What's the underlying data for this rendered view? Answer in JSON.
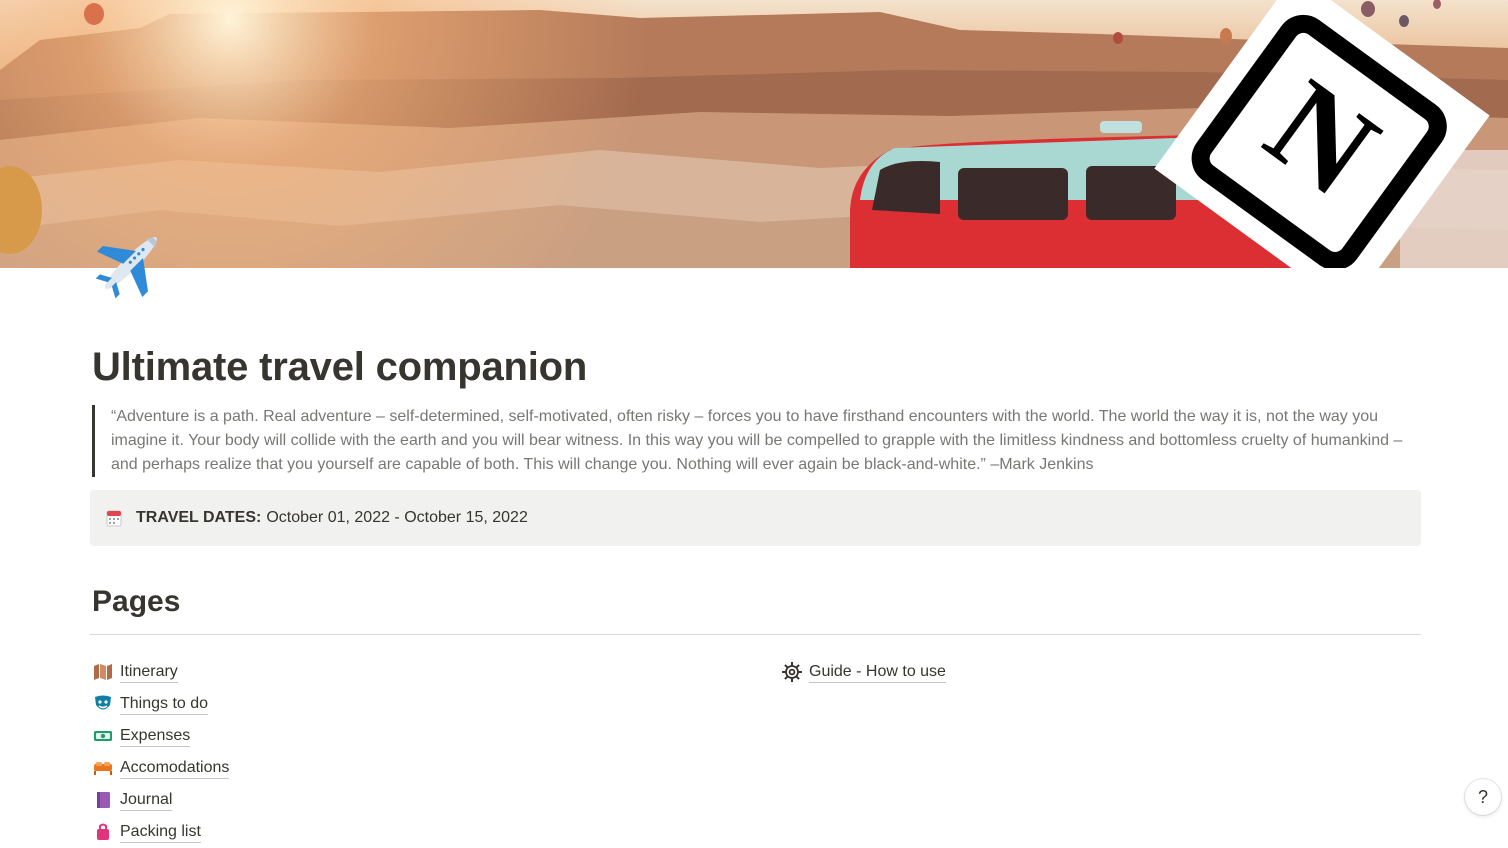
{
  "page": {
    "title": "Ultimate travel companion",
    "icon": "airplane-icon",
    "quote": "“Adventure is a path. Real adventure – self-determined, self-motivated, often risky – forces you to have firsthand encounters with the world. The world the way it is, not the way you imagine it. Your body will collide with the earth and you will bear witness. In this way you will be compelled to grapple with the limitless kindness and bottomless cruelty of humankind – and perhaps realize that you yourself are capable of both. This will change you. Nothing will ever again be black-and-white.” –Mark Jenkins"
  },
  "callout": {
    "icon": "calendar-icon",
    "label": "TRAVEL DATES:",
    "value": "October 01, 2022 - October 15, 2022"
  },
  "pages_section": {
    "heading": "Pages",
    "left_links": [
      {
        "label": "Itinerary",
        "icon": "map-icon"
      },
      {
        "label": "Things to do",
        "icon": "masks-icon"
      },
      {
        "label": "Expenses",
        "icon": "money-icon"
      },
      {
        "label": "Accomodations",
        "icon": "bed-icon"
      },
      {
        "label": "Journal",
        "icon": "book-icon"
      },
      {
        "label": "Packing list",
        "icon": "bag-icon"
      }
    ],
    "right_links": [
      {
        "label": "Guide - How to use",
        "icon": "gear-icon"
      }
    ]
  },
  "help": {
    "label": "?"
  },
  "colors": {
    "text": "#37352f",
    "muted": "#787774",
    "callout_bg": "#f1f1ef"
  }
}
